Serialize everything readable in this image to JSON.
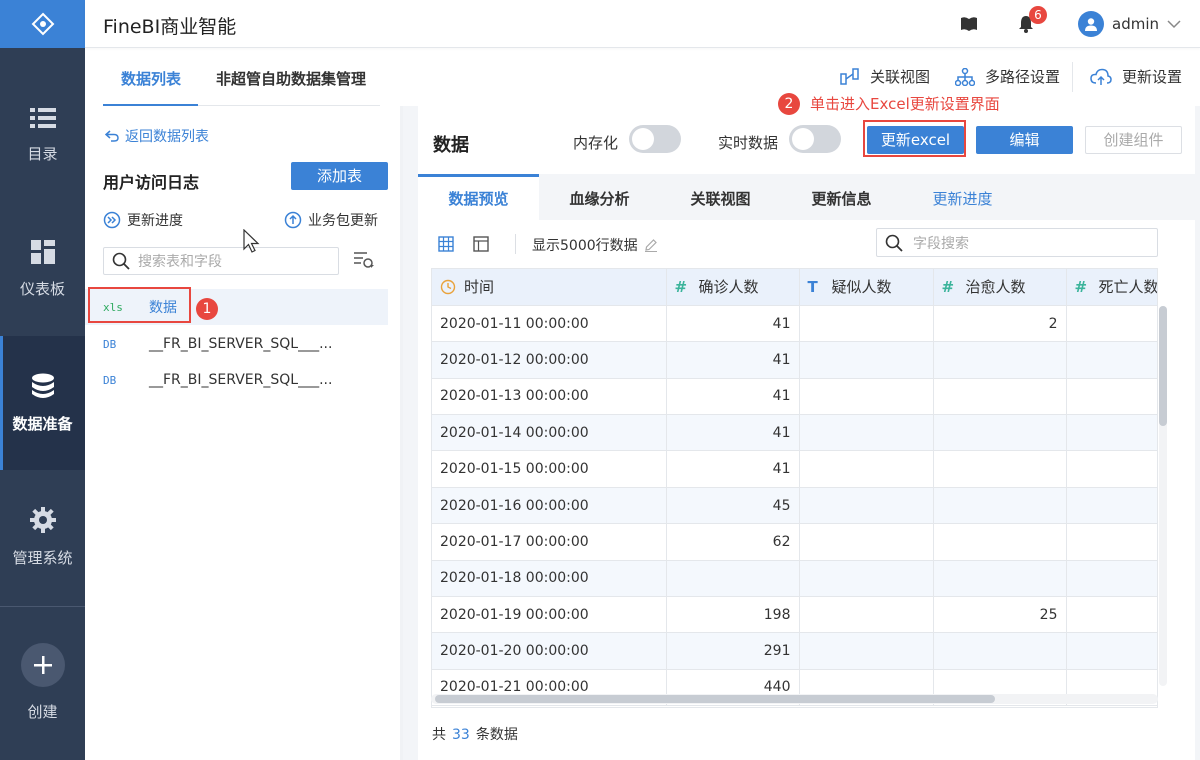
{
  "app": {
    "title": "FineBI商业智能"
  },
  "header": {
    "notification_count": "6",
    "user_name": "admin"
  },
  "leftnav": {
    "items": [
      {
        "label": "目录",
        "icon": "list-icon"
      },
      {
        "label": "仪表板",
        "icon": "dashboard-icon"
      },
      {
        "label": "数据准备",
        "icon": "database-icon",
        "active": true
      },
      {
        "label": "管理系统",
        "icon": "gear-icon"
      },
      {
        "label": "创建",
        "icon": "plus-icon"
      }
    ]
  },
  "top_tabs": [
    "数据列表",
    "非超管自助数据集管理"
  ],
  "top_actions": [
    "关联视图",
    "多路径设置",
    "更新设置"
  ],
  "left_panel": {
    "back_label": "返回数据列表",
    "title": "用户访问日志",
    "add_button": "添加表",
    "update_progress": "更新进度",
    "package_update": "业务包更新",
    "search_placeholder": "搜索表和字段",
    "datasets": [
      {
        "tag": "xls",
        "name": "数据"
      },
      {
        "tag": "DB",
        "name": "__FR_BI_SERVER_SQL___..."
      },
      {
        "tag": "DB",
        "name": "__FR_BI_SERVER_SQL___..."
      }
    ]
  },
  "annotations": {
    "step1": "1",
    "step2": "2",
    "step2_text": "单击进入Excel更新设置界面"
  },
  "right_panel": {
    "title": "数据",
    "in_memory_label": "内存化",
    "realtime_label": "实时数据",
    "update_excel_button": "更新excel",
    "edit_button": "编辑",
    "create_component_button": "创建组件",
    "sub_tabs": [
      "数据预览",
      "血缘分析",
      "关联视图",
      "更新信息",
      "更新进度"
    ],
    "show_rows": "显示5000行数据",
    "field_search_placeholder": "字段搜索",
    "columns": [
      {
        "type": "clock",
        "name": "时间"
      },
      {
        "type": "#",
        "name": "确诊人数"
      },
      {
        "type": "T",
        "name": "疑似人数"
      },
      {
        "type": "#",
        "name": "治愈人数"
      },
      {
        "type": "#",
        "name": "死亡人数"
      }
    ],
    "rows": [
      [
        "2020-01-11 00:00:00",
        "41",
        "",
        "2",
        ""
      ],
      [
        "2020-01-12 00:00:00",
        "41",
        "",
        "",
        ""
      ],
      [
        "2020-01-13 00:00:00",
        "41",
        "",
        "",
        ""
      ],
      [
        "2020-01-14 00:00:00",
        "41",
        "",
        "",
        ""
      ],
      [
        "2020-01-15 00:00:00",
        "41",
        "",
        "",
        ""
      ],
      [
        "2020-01-16 00:00:00",
        "45",
        "",
        "",
        ""
      ],
      [
        "2020-01-17 00:00:00",
        "62",
        "",
        "",
        ""
      ],
      [
        "2020-01-18 00:00:00",
        "",
        "",
        "",
        ""
      ],
      [
        "2020-01-19 00:00:00",
        "198",
        "",
        "25",
        ""
      ],
      [
        "2020-01-20 00:00:00",
        "291",
        "",
        "",
        ""
      ],
      [
        "2020-01-21 00:00:00",
        "440",
        "",
        "",
        ""
      ]
    ],
    "footer": {
      "prefix": "共",
      "count": "33",
      "suffix": "条数据"
    }
  },
  "colors": {
    "primary": "#3b82d6",
    "nav_bg": "#2f3e55",
    "annotation": "#e8473f"
  }
}
